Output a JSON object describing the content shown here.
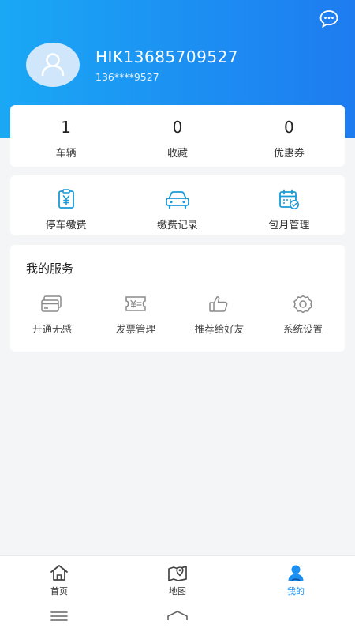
{
  "profile": {
    "username": "HIK13685709527",
    "phone": "136****9527"
  },
  "stats": [
    {
      "value": "1",
      "label": "车辆"
    },
    {
      "value": "0",
      "label": "收藏"
    },
    {
      "value": "0",
      "label": "优惠券"
    }
  ],
  "quick_actions": [
    {
      "label": "停车缴费",
      "icon": "parking-payment-icon"
    },
    {
      "label": "缴费记录",
      "icon": "car-icon"
    },
    {
      "label": "包月管理",
      "icon": "calendar-check-icon"
    }
  ],
  "services": {
    "title": "我的服务",
    "items": [
      {
        "label": "开通无感",
        "icon": "card-icon"
      },
      {
        "label": "发票管理",
        "icon": "invoice-icon"
      },
      {
        "label": "推荐给好友",
        "icon": "thumbs-up-icon"
      },
      {
        "label": "系统设置",
        "icon": "gear-icon"
      }
    ]
  },
  "tabbar": [
    {
      "label": "首页",
      "icon": "home-icon"
    },
    {
      "label": "地图",
      "icon": "map-icon"
    },
    {
      "label": "我的",
      "icon": "user-icon",
      "active": true
    }
  ],
  "colors": {
    "brand": "#1c8ff2",
    "header_start": "#1aa8f5",
    "header_end": "#1e7cf0",
    "icon_blue": "#1a9ad6",
    "icon_gray": "#888888"
  }
}
